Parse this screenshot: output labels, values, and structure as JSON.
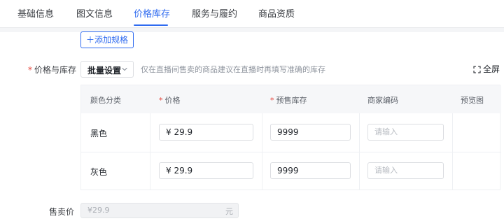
{
  "tabs": [
    {
      "label": "基础信息",
      "active": false
    },
    {
      "label": "图文信息",
      "active": false
    },
    {
      "label": "价格库存",
      "active": true
    },
    {
      "label": "服务与履约",
      "active": false
    },
    {
      "label": "商品资质",
      "active": false
    }
  ],
  "add_spec_button": "＋添加规格",
  "price_stock": {
    "label": "价格与库存",
    "batch_select_label": "批量设置",
    "hint": "仅在直播间售卖的商品建议在直播时再填写准确的库存",
    "fullscreen_label": "全屏"
  },
  "sku_table": {
    "headers": [
      "颜色分类",
      "价格",
      "预售库存",
      "商家编码",
      "预览图"
    ],
    "rows": [
      {
        "color": "黑色",
        "price": "¥  29.9",
        "stock": "9999",
        "merchant_code_placeholder": "请输入"
      },
      {
        "color": "灰色",
        "price": "¥  29.9",
        "stock": "9999",
        "merchant_code_placeholder": "请输入"
      }
    ]
  },
  "sale_price": {
    "label": "售卖价",
    "value": "¥29.9",
    "unit": "元"
  },
  "colors": {
    "accent": "#2f6bf0",
    "required": "#e5443b"
  }
}
